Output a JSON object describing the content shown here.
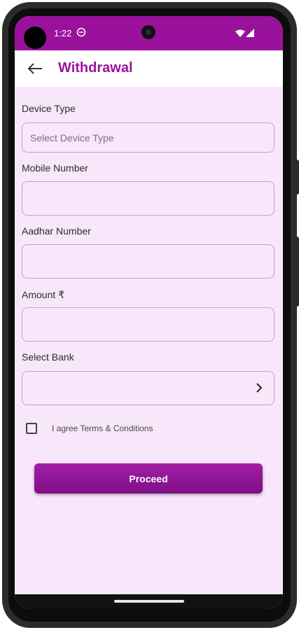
{
  "status_bar": {
    "time": "1:22",
    "background_color": "#9a129c"
  },
  "app_bar": {
    "title": "Withdrawal",
    "title_color": "#9a149c",
    "back_icon": "arrow-left-icon"
  },
  "form": {
    "device_type": {
      "label": "Device Type",
      "placeholder": "Select Device Type"
    },
    "mobile_number": {
      "label": "Mobile Number",
      "value": ""
    },
    "aadhar_number": {
      "label": "Aadhar Number",
      "value": ""
    },
    "amount": {
      "label": "Amount ₹",
      "value": ""
    },
    "select_bank": {
      "label": "Select Bank",
      "value": "",
      "icon": "chevron-right-icon"
    },
    "terms": {
      "label": "I agree Terms & Conditions",
      "checked": false
    }
  },
  "actions": {
    "proceed_label": "Proceed",
    "accent_color": "#8e1494"
  },
  "screen_background_color": "#f8e6fa"
}
